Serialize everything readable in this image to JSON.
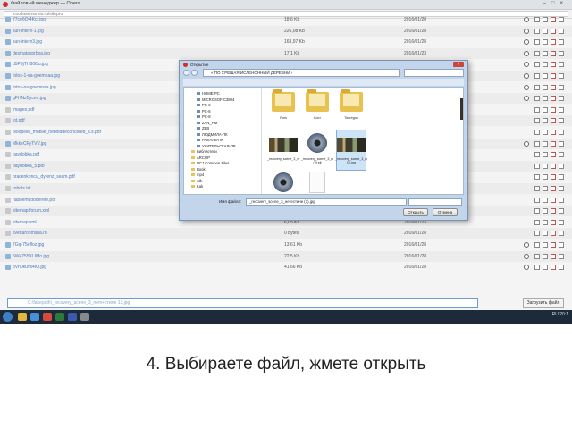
{
  "browser": {
    "title": "Файловый менеджер — Opera",
    "address": "coollasemorsis.ru/sitepro"
  },
  "files": [
    {
      "name": "77ce6Qf4Kcr.jpg",
      "size": "18,6 Kb",
      "date": "2016/01/28",
      "type": "img",
      "eye": true
    },
    {
      "name": "sun-intern-1.jpg",
      "size": "226,08 Kb",
      "date": "2016/01/28",
      "type": "img",
      "eye": true
    },
    {
      "name": "sun-intern3.jpg",
      "size": "163,97 Kb",
      "date": "2016/01/28",
      "type": "img",
      "eye": true
    },
    {
      "name": "desinatasprbxa.jpg",
      "size": "17,1 Kb",
      "date": "2016/01/23",
      "type": "img",
      "eye": true
    },
    {
      "name": "d5P9jTH8G5u.jpg",
      "size": "",
      "date": "",
      "type": "img",
      "eye": true
    },
    {
      "name": "fotos-1-na-goemnaa.jpg",
      "size": "",
      "date": "",
      "type": "img",
      "eye": true
    },
    {
      "name": "fotos-na-goemnaa.jpg",
      "size": "",
      "date": "",
      "type": "img",
      "eye": true
    },
    {
      "name": "gFHNzBycen.jpg",
      "size": "",
      "date": "",
      "type": "img",
      "eye": true
    },
    {
      "name": "images.pdf",
      "size": "",
      "date": "",
      "type": "doc",
      "eye": false
    },
    {
      "name": "iot.pdf",
      "size": "",
      "date": "",
      "type": "doc",
      "eye": false
    },
    {
      "name": "bloopelio_mobile_nebolddeconcered_s.s.pdf",
      "size": "",
      "date": "",
      "type": "doc",
      "eye": false
    },
    {
      "name": "MkkeCFyTVV.jpg",
      "size": "",
      "date": "",
      "type": "img",
      "eye": true
    },
    {
      "name": "paydobka.pdf",
      "size": "",
      "date": "",
      "type": "doc",
      "eye": false
    },
    {
      "name": "paydobka_5.pdf",
      "size": "",
      "date": "",
      "type": "doc",
      "eye": false
    },
    {
      "name": "pracenkoncu_dyrenz_seam.pdf",
      "size": "",
      "date": "",
      "type": "doc",
      "eye": false
    },
    {
      "name": "robots.txt",
      "size": "",
      "date": "",
      "type": "doc",
      "eye": false
    },
    {
      "name": "nabliemudoderete.pdf",
      "size": "",
      "date": "",
      "type": "doc",
      "eye": false
    },
    {
      "name": "sitemap-forum.xml",
      "size": "",
      "date": "",
      "type": "doc",
      "eye": false
    },
    {
      "name": "sitemap.xml",
      "size": "6,05 Kb",
      "date": "2016/01/23",
      "type": "doc",
      "eye": false
    },
    {
      "name": "svettaronmsna.ru",
      "size": "0 bytes",
      "date": "2016/01/28",
      "type": "doc",
      "eye": false
    },
    {
      "name": "7Gq-75efloz.jpg",
      "size": "13,61 Kb",
      "date": "2016/01/28",
      "type": "img",
      "eye": true
    },
    {
      "name": "5W4755XLIMo.jpg",
      "size": "22,5 Kb",
      "date": "2016/01/28",
      "type": "img",
      "eye": true
    },
    {
      "name": "8Vh0kuvs4IQ.jpg",
      "size": "41,66 Kb",
      "date": "2016/01/28",
      "type": "img",
      "eye": true
    }
  ],
  "upload": {
    "path": "C:\\fakepath\\_recovery_scene_3_nеm+стиле 13.jpg",
    "button": "Загрузить файл"
  },
  "taskbar": {
    "lang": "RU",
    "time": "20:1"
  },
  "dialog": {
    "title": "Открытие",
    "close": "×",
    "path": "« ПО У.РЕШАЯ ИСЛЕНОННЫЙ ДЕРЕВНИ ›",
    "tree": [
      {
        "label": "HOME-PC",
        "folder": false
      },
      {
        "label": "MICROSOF-C3804",
        "folder": false
      },
      {
        "label": "PC-6",
        "folder": false
      },
      {
        "label": "PC-6",
        "folder": false
      },
      {
        "label": "PC-8",
        "folder": false
      },
      {
        "label": "ZAN_HM",
        "folder": false
      },
      {
        "label": "ZBB",
        "folder": false
      },
      {
        "label": "ЛЮДМИЛА-ПК",
        "folder": false
      },
      {
        "label": "РАИАЛЬ-ПК",
        "folder": false
      },
      {
        "label": "УЧИТЕЛЬСКАЯ-ПВ",
        "folder": false
      },
      {
        "label": "Библиотеки",
        "folder": true
      },
      {
        "label": "ARCOP",
        "folder": true
      },
      {
        "label": "NCJ Common Files",
        "folder": true
      },
      {
        "label": "Book",
        "folder": true
      },
      {
        "label": "mp4",
        "folder": true
      },
      {
        "label": "sdk",
        "folder": true
      },
      {
        "label": "Kak",
        "folder": true
      }
    ],
    "items": [
      {
        "label": "Rum",
        "kind": "folder"
      },
      {
        "label": "Kост",
        "kind": "folder"
      },
      {
        "label": "Текстуры",
        "kind": "folder"
      },
      {
        "label": "_recovery_scene_3_нетестине\\6.jpg",
        "kind": "photo"
      },
      {
        "label": "_recovery_scene_3_нетестине (2).stl",
        "kind": "cd"
      },
      {
        "label": "_recovery_scene_3_нетестине (3).jpg",
        "kind": "photo"
      },
      {
        "label": "",
        "kind": "cd"
      },
      {
        "label": "",
        "kind": "paper"
      }
    ],
    "filename_label": "Имя файла:",
    "filename": "_recovery_scene_3_нетестине (3).jpg",
    "filetype": "",
    "open_button": "Открыть",
    "cancel_button": "Отмена"
  },
  "caption": "4. Выбираете файл, жмете открыть"
}
